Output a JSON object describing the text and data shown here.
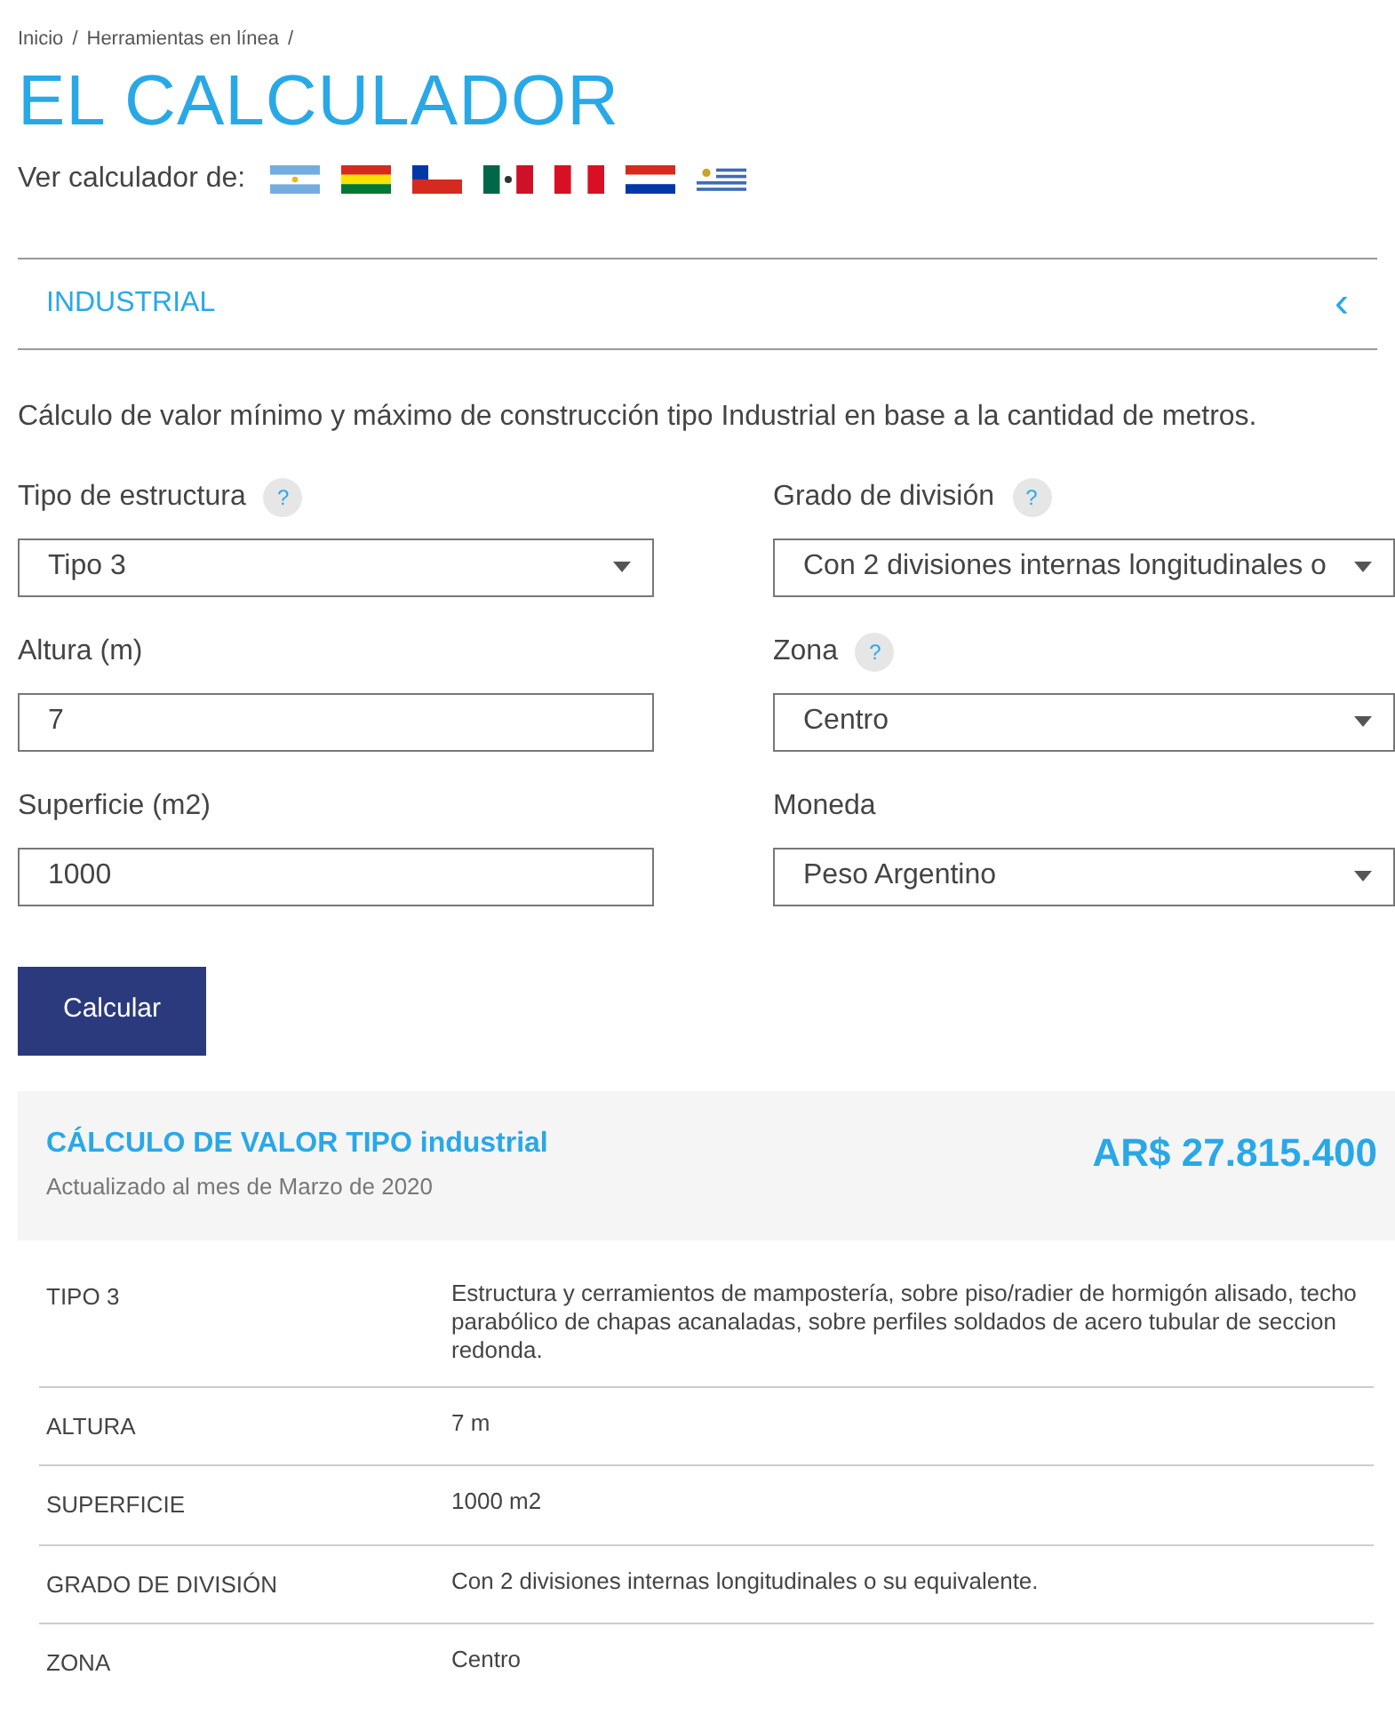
{
  "breadcrumb": [
    "Inicio",
    "/",
    "Herramientas en línea",
    "/"
  ],
  "title": "EL CALCULADOR",
  "country_label": "Ver calculador de:",
  "accordion": {
    "label": "INDUSTRIAL",
    "expanded": true,
    "chevron": "‹"
  },
  "description": "Cálculo de valor mínimo y máximo de construcción tipo Industrial en base a la cantidad de metros.",
  "fields": [
    {
      "label": "Tipo de estructura",
      "help": "?",
      "kind": "select",
      "value": "Tipo 3"
    },
    {
      "label": "Grado de división",
      "help": "?",
      "kind": "select",
      "value": "Con 2 divisiones internas longitudinales o"
    },
    {
      "label": "Altura (m)",
      "kind": "text",
      "value": "7"
    },
    {
      "label": "Zona",
      "help": "?",
      "kind": "select",
      "value": "Centro"
    },
    {
      "label": "Superficie (m2)",
      "kind": "text",
      "value": "1000"
    },
    {
      "label": "Moneda",
      "kind": "select",
      "value": "Peso Argentino"
    }
  ],
  "button": "Calcular",
  "result": {
    "title": "CÁLCULO DE VALOR TIPO industrial",
    "subtitle": "Actualizado al mes de Marzo de 2020",
    "amount": "AR$ 27.815.400"
  },
  "details": [
    {
      "label": "TIPO 3",
      "value": "Estructura y cerramientos de mampostería, sobre piso/radier de hormigón alisado, techo parabólico de chapas acanaladas, sobre perfiles soldados de acero tubular de seccion redonda."
    },
    {
      "label": "ALTURA",
      "value": "7 m"
    },
    {
      "label": "SUPERFICIE",
      "value": "1000 m2"
    },
    {
      "label": "GRADO DE DIVISIÓN",
      "value": "Con 2 divisiones internas longitudinales o su equivalente."
    },
    {
      "label": "ZONA",
      "value": "Centro"
    }
  ]
}
